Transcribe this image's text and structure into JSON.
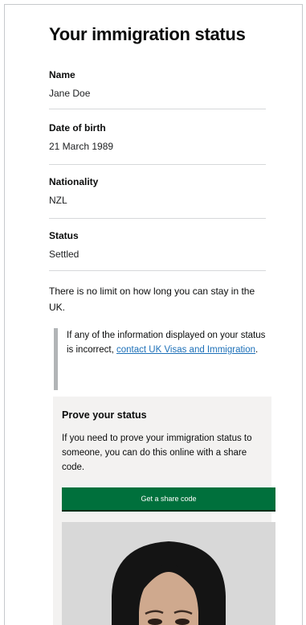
{
  "page": {
    "title": "Your immigration status"
  },
  "fields": [
    {
      "label": "Name",
      "value": "Jane Doe"
    },
    {
      "label": "Date of birth",
      "value": "21 March 1989"
    },
    {
      "label": "Nationality",
      "value": "NZL"
    },
    {
      "label": "Status",
      "value": "Settled"
    }
  ],
  "status_note": "There is no limit on how long you can stay in the UK.",
  "inset": {
    "text": "If any of the information displayed on your status is incorrect, ",
    "link": "contact UK Visas and Immigration",
    "end": "."
  },
  "prove": {
    "heading": "Prove your status",
    "body": "If you need to prove your immigration status to someone, you can do this online with a share code.",
    "button": "Get a share code"
  },
  "colors": {
    "button_green": "#00703c",
    "link_blue": "#1d70b8",
    "inset_border": "#b1b4b6",
    "card_background": "#f3f2f1"
  }
}
